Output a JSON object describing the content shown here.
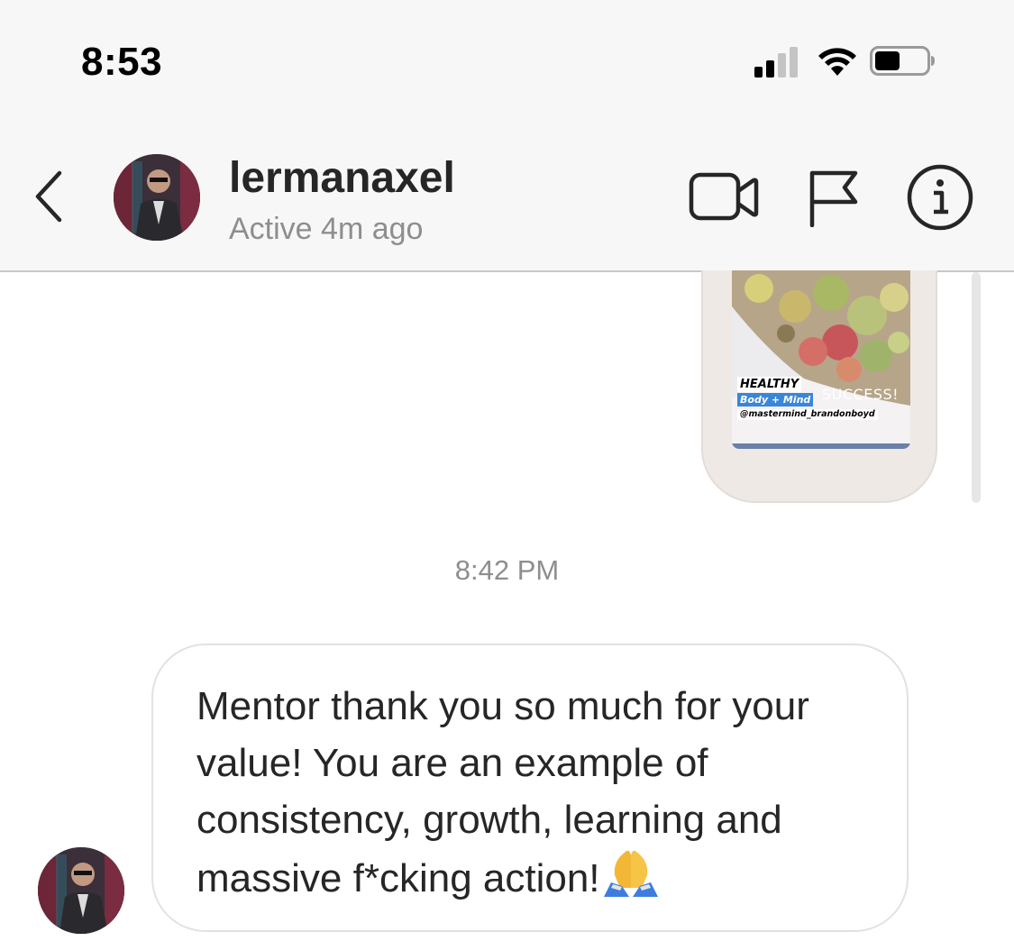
{
  "status_bar": {
    "time": "8:53",
    "signal_icon": "cellular-signal-icon",
    "wifi_icon": "wifi-icon",
    "battery_icon": "battery-icon",
    "battery_level": 0.5
  },
  "header": {
    "back_icon": "chevron-left-icon",
    "username": "lermanaxel",
    "activity_status": "Active 4m ago",
    "video_icon": "video-camera-icon",
    "flag_icon": "flag-icon",
    "info_icon": "info-icon"
  },
  "conversation": {
    "shared_post": {
      "overlay_tags": {
        "healthy": "HEALTHY",
        "body_mind": "Body + Mind",
        "handle": "@mastermind_brandonboyd",
        "success": "SUCCESS!"
      }
    },
    "timestamp": "8:42 PM",
    "message": {
      "text": "Mentor thank you so much for your value! You are an example of consistency, growth, learning and massive f*cking action!",
      "emoji": "folded-hands-icon"
    }
  },
  "colors": {
    "header_bg": "#f7f7f7",
    "muted_text": "#8e8e8e",
    "primary_text": "#262626",
    "bubble_border": "#e2e2e2"
  }
}
